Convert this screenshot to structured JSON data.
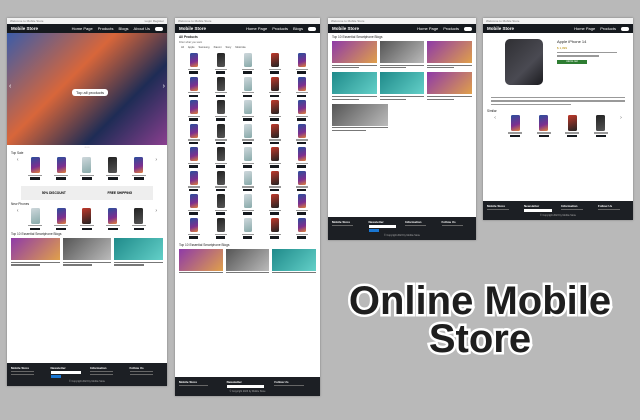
{
  "store_name": "Mobile Store",
  "nav": {
    "home": "Home Page",
    "products": "Products",
    "blogs": "Blogs",
    "about": "About Us"
  },
  "top_strip": {
    "left": "Welcome to Mobile Store",
    "login": "Login",
    "register": "Register"
  },
  "hero": {
    "badge": "Top all products"
  },
  "home": {
    "top_sale": "Top Sale",
    "new_phones": "New Phones",
    "blogs_title": "Top 10 Essential Smartphone Blogs",
    "promo_left": "50% DISCOUNT",
    "promo_right": "FREE SHIPPING"
  },
  "products": {
    "title": "All Products",
    "subtitle": "Filter what you want",
    "filters": [
      "All",
      "Apple",
      "Samsung",
      "Xiaomi",
      "Sony",
      "Motorola"
    ],
    "blogs_title": "Top 10 Essential Smartphone Blogs"
  },
  "blogs_page": {
    "title": "Top 10 Essential Smartphone Blogs"
  },
  "detail": {
    "product_name": "Apple iPhone 14",
    "price": "$ 1,099",
    "add_button": "Add to cart",
    "similar": "Similar"
  },
  "footer": {
    "about": "Mobile Store",
    "newsletter": "Newsletter",
    "information": "Information",
    "follow": "Follow Us",
    "copyright": "© Copyright 2023 by Mobile Store"
  },
  "headline": {
    "line1": "Online Mobile",
    "line2": "Store"
  },
  "colors": {
    "nav": "#15191e",
    "footer": "#1c1f24",
    "accent": "#1976d2",
    "background": "#b9b9b9"
  }
}
